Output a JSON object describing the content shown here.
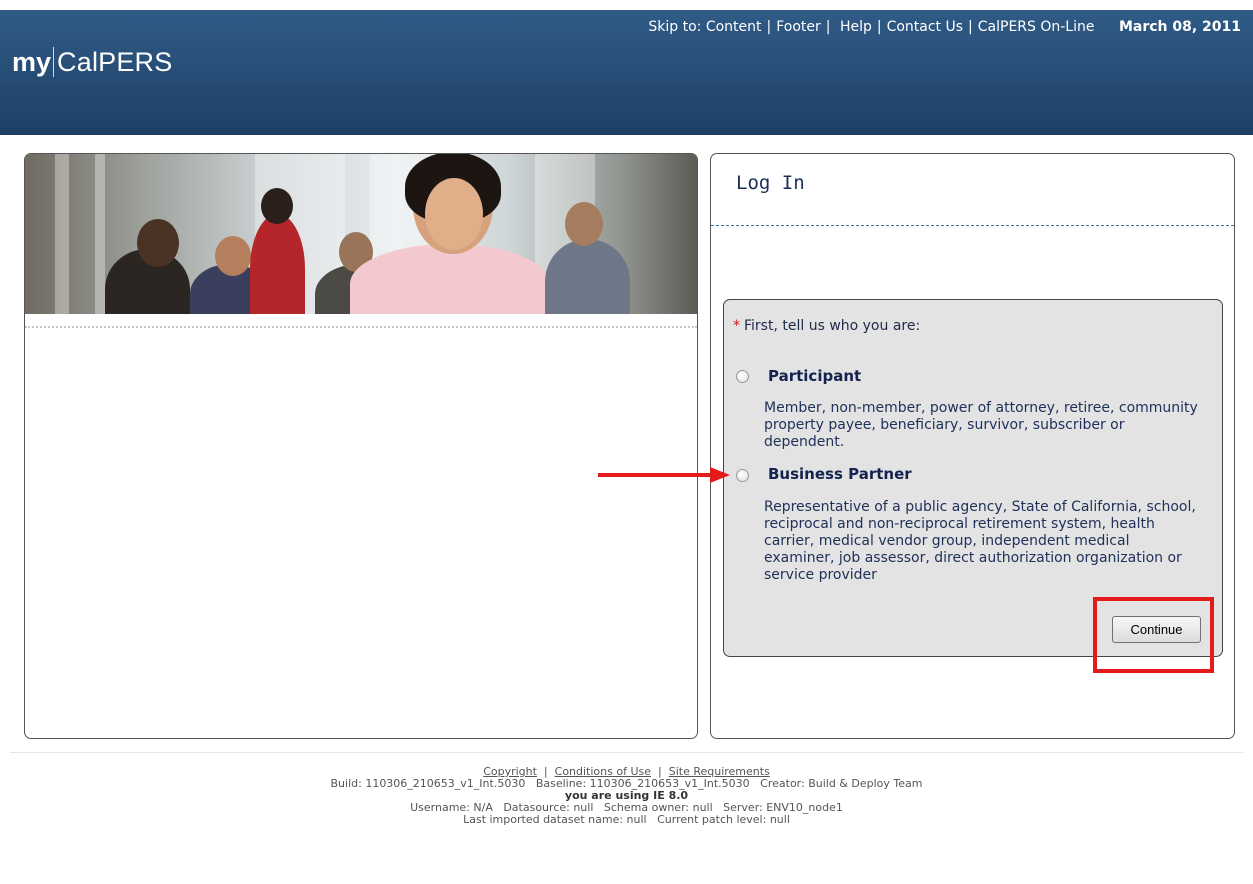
{
  "header": {
    "logo_my": "my",
    "logo_brand": "CalPERS",
    "nav": {
      "skip_label": "Skip to: Content",
      "footer": "Footer",
      "help": "Help",
      "contact": "Contact Us",
      "online": "CalPERS On-Line",
      "date": "March 08, 2011"
    }
  },
  "login": {
    "title": "Log In",
    "required_mark": "*",
    "prompt": "First, tell us who you are:",
    "options": [
      {
        "title": "Participant",
        "description": "Member, non-member, power of attorney, retiree, community property payee, beneficiary, survivor, subscriber or dependent."
      },
      {
        "title": "Business Partner",
        "description": "Representative of a public agency, State of California, school, reciprocal and non-reciprocal retirement system, health carrier, medical vendor group, independent medical examiner, job assessor, direct authorization organization or service provider"
      }
    ],
    "continue_label": "Continue"
  },
  "footer": {
    "links": [
      "Copyright",
      "Conditions of Use",
      "Site Requirements"
    ],
    "build_line": "Build: 110306_210653_v1_Int.5030   Baseline: 110306_210653_v1_Int.5030   Creator: Build & Deploy Team",
    "browser_line": "you are using IE 8.0",
    "user_line": "Username: N/A   Datasource: null   Schema owner: null   Server: ENV10_node1",
    "import_line": "Last imported dataset name: null   Current patch level: null"
  },
  "colors": {
    "header_blue": "#284f78",
    "annotation_red": "#e31b1b",
    "title_navy": "#13224e"
  }
}
